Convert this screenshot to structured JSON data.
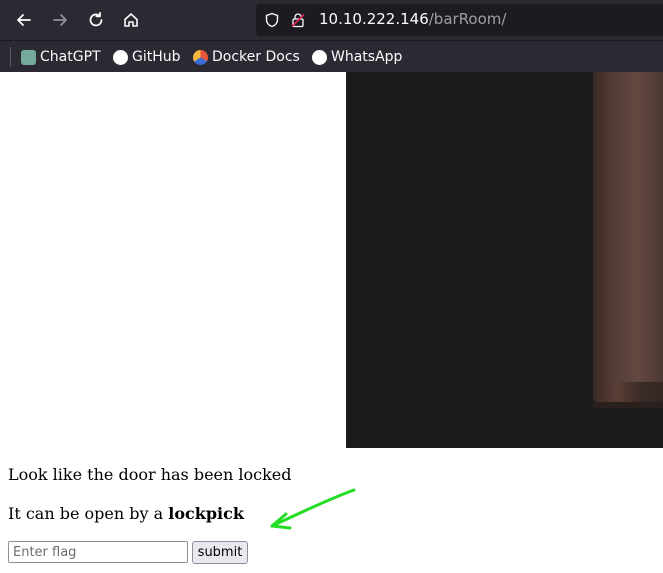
{
  "browser": {
    "url_host": "10.10.222.146",
    "url_path": "/barRoom/",
    "bookmarks": [
      {
        "label": "ChatGPT",
        "icon": "chatgpt-icon",
        "color": "#74aa9c"
      },
      {
        "label": "GitHub",
        "icon": "github-icon",
        "color": "#ffffff"
      },
      {
        "label": "Docker Docs",
        "icon": "docker-icon",
        "color": "#e4563b"
      },
      {
        "label": "WhatsApp",
        "icon": "whatsapp-icon",
        "color": "#ffffff"
      }
    ]
  },
  "page": {
    "line1": "Look like the door has been locked",
    "line2_prefix": "It can be open by a ",
    "line2_bold": "lockpick",
    "flag_placeholder": "Enter flag",
    "submit_label": "submit"
  },
  "colors": {
    "annotation_arrow": "#22dd22",
    "chrome_bg": "#2b2a33"
  }
}
